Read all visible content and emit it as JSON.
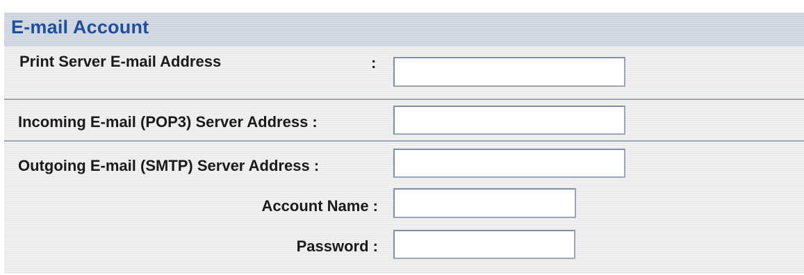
{
  "section": {
    "title": "E-mail Account"
  },
  "fields": {
    "print_server_email": {
      "label": "Print Server E-mail Address",
      "colon": ":",
      "value": ""
    },
    "incoming_pop3": {
      "label": "Incoming E-mail (POP3) Server Address :",
      "value": ""
    },
    "outgoing_smtp": {
      "label": "Outgoing E-mail (SMTP) Server Address :",
      "value": ""
    },
    "account_name": {
      "label": "Account Name :",
      "value": ""
    },
    "password": {
      "label": "Password :",
      "value": ""
    }
  },
  "colors": {
    "header_text": "#1f4e9c",
    "header_bg": "#cfd6e0",
    "panel_bg": "#ececec"
  }
}
